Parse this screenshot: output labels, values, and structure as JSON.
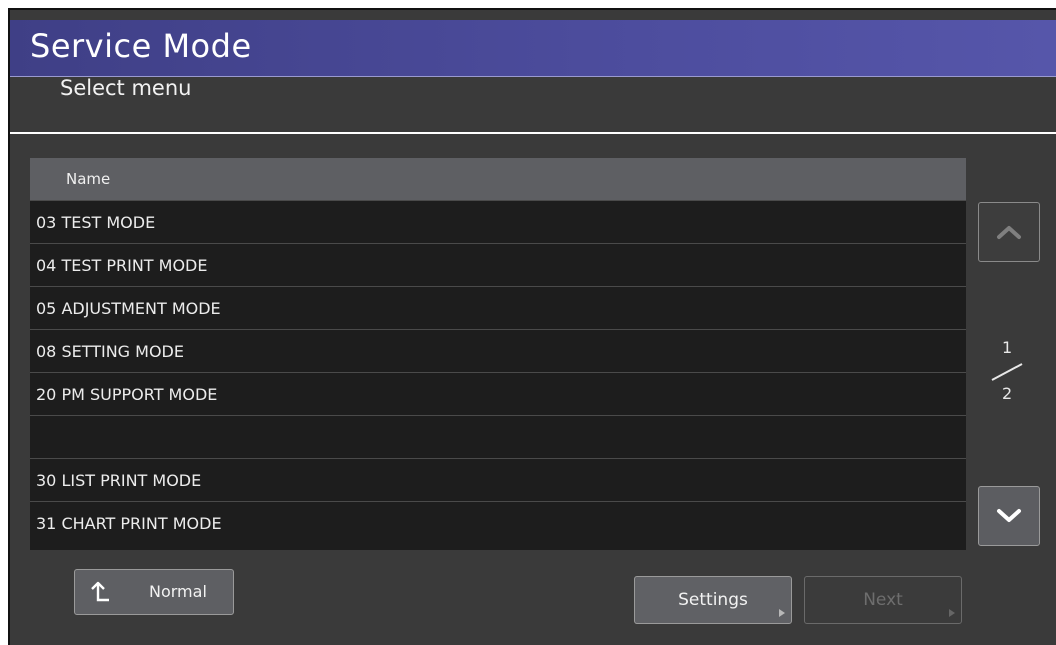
{
  "header": {
    "title": "Service Mode",
    "subtitle": "Select menu"
  },
  "table": {
    "column": "Name",
    "rows": [
      "03 TEST MODE",
      "04 TEST PRINT MODE",
      "05 ADJUSTMENT MODE",
      "08 SETTING MODE",
      "20 PM SUPPORT MODE",
      "",
      "30 LIST PRINT MODE",
      "31 CHART PRINT MODE"
    ]
  },
  "pager": {
    "current": "1",
    "total": "2"
  },
  "buttons": {
    "normal": "Normal",
    "settings": "Settings",
    "next": "Next"
  },
  "colors": {
    "title_bar": "#4d4d9e",
    "background": "#3a3a3a",
    "list_bg": "#1d1d1d",
    "header_row": "#5e5f63"
  },
  "icons": {
    "scroll_up": "chevron-up-icon",
    "scroll_down": "chevron-down-icon",
    "normal": "return-arrow-icon"
  }
}
